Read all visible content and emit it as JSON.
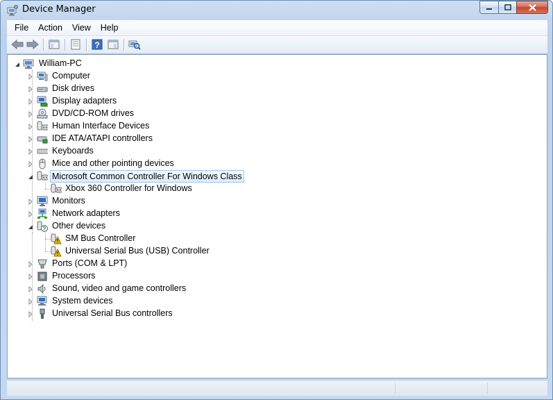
{
  "window": {
    "title": "Device Manager"
  },
  "menu": [
    "File",
    "Action",
    "View",
    "Help"
  ],
  "toolbar": {
    "buttons": [
      "back-icon",
      "forward-icon",
      "show-hide-console-tree-icon",
      "properties-icon",
      "help-icon",
      "action-pane-icon",
      "scan-hardware-icon"
    ]
  },
  "tree": {
    "root": "William-PC",
    "items": [
      {
        "label": "Computer",
        "icon": "computer-icon"
      },
      {
        "label": "Disk drives",
        "icon": "disk-drive-icon"
      },
      {
        "label": "Display adapters",
        "icon": "display-adapter-icon"
      },
      {
        "label": "DVD/CD-ROM drives",
        "icon": "dvd-drive-icon"
      },
      {
        "label": "Human Interface Devices",
        "icon": "hid-icon"
      },
      {
        "label": "IDE ATA/ATAPI controllers",
        "icon": "ide-controller-icon"
      },
      {
        "label": "Keyboards",
        "icon": "keyboard-icon"
      },
      {
        "label": "Mice and other pointing devices",
        "icon": "mouse-icon"
      },
      {
        "label": "Microsoft Common Controller For Windows Class",
        "icon": "game-controller-icon",
        "expanded": true,
        "selected": true,
        "children": [
          {
            "label": "Xbox 360 Controller for Windows",
            "icon": "game-controller-icon"
          }
        ]
      },
      {
        "label": "Monitors",
        "icon": "monitor-icon"
      },
      {
        "label": "Network adapters",
        "icon": "network-adapter-icon"
      },
      {
        "label": "Other devices",
        "icon": "unknown-device-icon",
        "expanded": true,
        "children": [
          {
            "label": "SM Bus Controller",
            "icon": "warning-device-icon"
          },
          {
            "label": "Universal Serial Bus (USB) Controller",
            "icon": "warning-device-icon"
          }
        ]
      },
      {
        "label": "Ports (COM & LPT)",
        "icon": "port-icon"
      },
      {
        "label": "Processors",
        "icon": "processor-icon"
      },
      {
        "label": "Sound, video and game controllers",
        "icon": "sound-icon"
      },
      {
        "label": "System devices",
        "icon": "system-device-icon"
      },
      {
        "label": "Universal Serial Bus controllers",
        "icon": "usb-icon"
      }
    ]
  },
  "colors": {
    "selection_bg": "#dcecfc",
    "selection_border": "#9ec5ec",
    "warning": "#f2c200"
  }
}
